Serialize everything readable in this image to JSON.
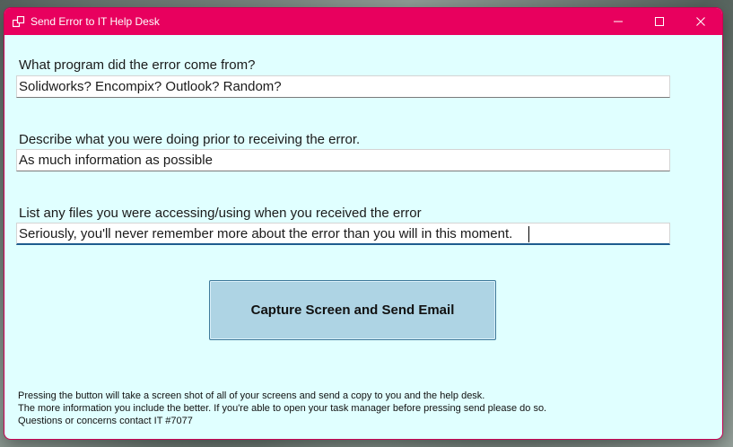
{
  "window": {
    "title": "Send Error to IT Help Desk",
    "titlebar_color": "#e8005e",
    "background_color": "#e0ffff"
  },
  "form": {
    "q1": {
      "label": "What program did the error come from?",
      "value": "Solidworks? Encompix? Outlook? Random?"
    },
    "q2": {
      "label": "Describe what you were doing prior to receiving the error.",
      "value": "As much information as possible"
    },
    "q3": {
      "label": "List any files you were accessing/using when you received the error",
      "value": "Seriously, you'll never remember more about the error than you will in this moment."
    }
  },
  "action": {
    "capture_label": "Capture Screen and Send Email",
    "button_color": "#aed4e4"
  },
  "notes": {
    "line1": "Pressing the button will take a screen shot of all of your screens and send a copy to you and the help desk.",
    "line2": "The more information you include the better. If you're able to open your task manager before pressing send please do so.",
    "line3": "Questions or concerns contact IT #7077"
  }
}
